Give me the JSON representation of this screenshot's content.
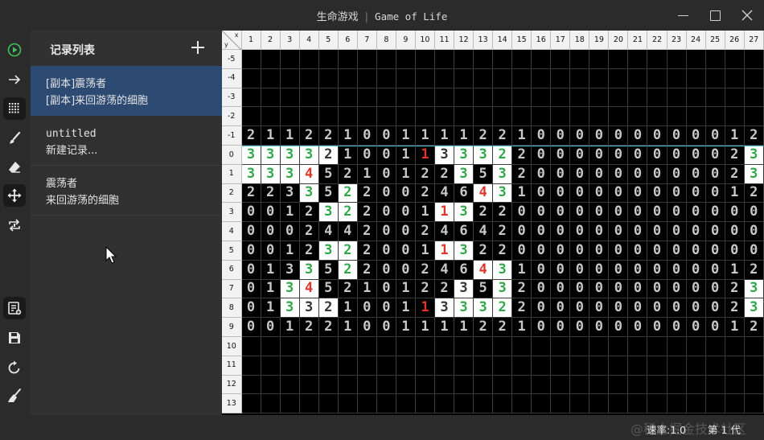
{
  "window": {
    "title_cn": "生命游戏",
    "title_en": "Game of Life"
  },
  "toolbar": {
    "tools": [
      {
        "name": "play-icon",
        "color": "#3cc35a"
      },
      {
        "name": "step-forward-icon"
      },
      {
        "name": "grid-dots-icon",
        "active": true
      },
      {
        "name": "brush-icon"
      },
      {
        "name": "eraser-icon"
      },
      {
        "name": "move-icon",
        "active": true
      },
      {
        "name": "swap-icon"
      },
      {
        "name": "save-to-record-icon",
        "active": true
      },
      {
        "name": "save-icon"
      },
      {
        "name": "reset-icon"
      },
      {
        "name": "clear-broom-icon"
      }
    ]
  },
  "panel": {
    "title": "记录列表",
    "records": [
      {
        "line1": "[副本]震荡者",
        "line2": "[副本]来回游荡的细胞",
        "selected": true
      },
      {
        "line1": "untitled",
        "line2": "新建记录...",
        "selected": false
      },
      {
        "line1": "震荡者",
        "line2": "来回游荡的细胞",
        "selected": false
      }
    ]
  },
  "grid": {
    "corner_x": "x",
    "corner_y": "y",
    "col_headers": [
      "1",
      "2",
      "3",
      "4",
      "5",
      "6",
      "7",
      "8",
      "9",
      "10",
      "11",
      "12",
      "13",
      "14",
      "15",
      "16",
      "17",
      "18",
      "19",
      "20",
      "21",
      "22",
      "23",
      "24",
      "25",
      "26",
      "27"
    ],
    "row_headers": [
      "-5",
      "-4",
      "-3",
      "-2",
      "-1",
      "0",
      "1",
      "2",
      "3",
      "4",
      "5",
      "6",
      "7",
      "8",
      "9",
      "10",
      "11",
      "12",
      "13"
    ],
    "rows": [
      "                           ",
      "                           ",
      "                           ",
      "                           ",
      "211221001111221000000000012",
      "333321001133322000000000023",
      "333452101223532000000000023",
      "223352200246431000000000012",
      "001232200113220000000000000",
      "000244200246420000000000000",
      "001232200113220000000000000",
      "013352200246431000000000012",
      "013452101223532000000000023",
      "013321001133322000000000023",
      "001221001111221000000000012",
      "                           ",
      "                           ",
      "                           ",
      "                           "
    ],
    "live": [
      [
        5,
        1
      ],
      [
        5,
        2
      ],
      [
        5,
        3
      ],
      [
        5,
        4
      ],
      [
        5,
        5
      ],
      [
        5,
        11
      ],
      [
        5,
        12
      ],
      [
        5,
        13
      ],
      [
        5,
        14
      ],
      [
        5,
        27
      ],
      [
        6,
        1
      ],
      [
        6,
        2
      ],
      [
        6,
        3
      ],
      [
        6,
        4
      ],
      [
        6,
        12
      ],
      [
        6,
        14
      ],
      [
        6,
        27
      ],
      [
        7,
        4
      ],
      [
        7,
        6
      ],
      [
        7,
        13
      ],
      [
        7,
        14
      ],
      [
        8,
        5
      ],
      [
        8,
        6
      ],
      [
        8,
        11
      ],
      [
        8,
        12
      ],
      [
        10,
        5
      ],
      [
        10,
        6
      ],
      [
        10,
        11
      ],
      [
        10,
        12
      ],
      [
        11,
        4
      ],
      [
        11,
        6
      ],
      [
        11,
        13
      ],
      [
        11,
        14
      ],
      [
        12,
        3
      ],
      [
        12,
        4
      ],
      [
        12,
        12
      ],
      [
        12,
        14
      ],
      [
        12,
        27
      ],
      [
        13,
        3
      ],
      [
        13,
        4
      ],
      [
        13,
        5
      ],
      [
        13,
        11
      ],
      [
        13,
        12
      ],
      [
        13,
        13
      ],
      [
        13,
        14
      ],
      [
        13,
        27
      ]
    ],
    "colors": {
      "green": "#2fa84a",
      "red": "#e0352b",
      "green_cells": [
        [
          5,
          1
        ],
        [
          5,
          2
        ],
        [
          5,
          3
        ],
        [
          5,
          4
        ],
        [
          5,
          12
        ],
        [
          5,
          13
        ],
        [
          5,
          14
        ],
        [
          5,
          27
        ],
        [
          6,
          1
        ],
        [
          6,
          2
        ],
        [
          6,
          3
        ],
        [
          6,
          12
        ],
        [
          6,
          14
        ],
        [
          6,
          27
        ],
        [
          7,
          4
        ],
        [
          7,
          6
        ],
        [
          7,
          14
        ],
        [
          8,
          5
        ],
        [
          8,
          6
        ],
        [
          8,
          12
        ],
        [
          10,
          5
        ],
        [
          10,
          6
        ],
        [
          10,
          12
        ],
        [
          11,
          4
        ],
        [
          11,
          6
        ],
        [
          11,
          14
        ],
        [
          12,
          3
        ],
        [
          12,
          14
        ],
        [
          12,
          27
        ],
        [
          13,
          3
        ],
        [
          13,
          12
        ],
        [
          13,
          13
        ],
        [
          13,
          14
        ],
        [
          13,
          27
        ]
      ],
      "red_cells": [
        [
          5,
          10
        ],
        [
          6,
          4
        ],
        [
          7,
          13
        ],
        [
          8,
          11
        ],
        [
          10,
          11
        ],
        [
          11,
          13
        ],
        [
          12,
          4
        ],
        [
          13,
          10
        ]
      ]
    }
  },
  "status": {
    "speed": "速率:1.0",
    "generation": "第 1 代",
    "watermark": "@稀土掘金技术社区"
  }
}
